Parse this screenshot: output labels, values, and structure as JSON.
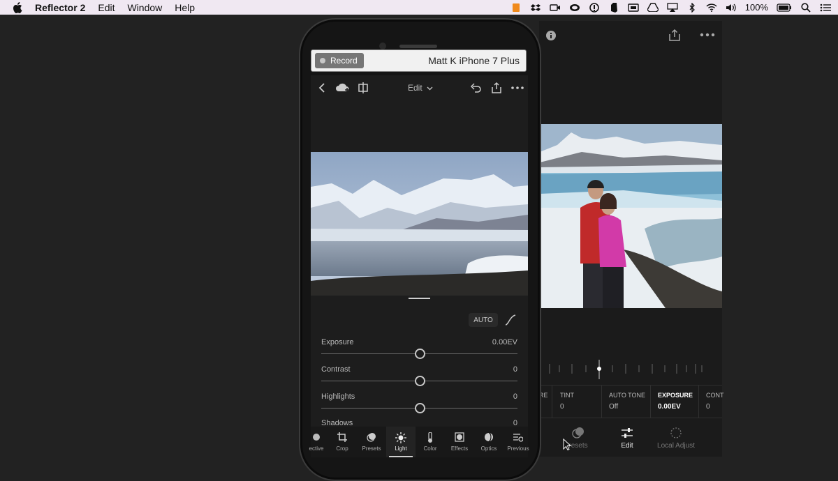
{
  "menubar": {
    "app_name": "Reflector 2",
    "items": [
      "Edit",
      "Window",
      "Help"
    ],
    "battery": "100%"
  },
  "recorder": {
    "record_label": "Record",
    "device_name": "Matt K iPhone 7 Plus"
  },
  "phone_app": {
    "mode_label": "Edit",
    "auto_label": "AUTO",
    "sliders": [
      {
        "label": "Exposure",
        "value": "0.00EV",
        "position": 0.5
      },
      {
        "label": "Contrast",
        "value": "0",
        "position": 0.5
      },
      {
        "label": "Highlights",
        "value": "0",
        "position": 0.5
      },
      {
        "label": "Shadows",
        "value": "0",
        "position": 0.5
      }
    ],
    "tabs": [
      {
        "label": "ective",
        "icon": "selective-icon"
      },
      {
        "label": "Crop",
        "icon": "crop-icon"
      },
      {
        "label": "Presets",
        "icon": "presets-icon"
      },
      {
        "label": "Light",
        "icon": "light-icon",
        "active": true
      },
      {
        "label": "Color",
        "icon": "color-icon"
      },
      {
        "label": "Effects",
        "icon": "effects-icon"
      },
      {
        "label": "Optics",
        "icon": "optics-icon"
      },
      {
        "label": "Previous",
        "icon": "previous-icon"
      }
    ]
  },
  "desktop_app": {
    "params": [
      {
        "label": "RE",
        "value": ""
      },
      {
        "label": "TINT",
        "value": "0"
      },
      {
        "label": "AUTO TONE",
        "value": "Off"
      },
      {
        "label": "EXPOSURE",
        "value": "0.00EV",
        "selected": true
      },
      {
        "label": "CONT",
        "value": "0"
      }
    ],
    "tabs": [
      {
        "label": "resets",
        "icon": "presets-icon"
      },
      {
        "label": "Edit",
        "icon": "sliders-icon",
        "active": true
      },
      {
        "label": "Local Adjust",
        "icon": "local-adjust-icon"
      }
    ]
  }
}
